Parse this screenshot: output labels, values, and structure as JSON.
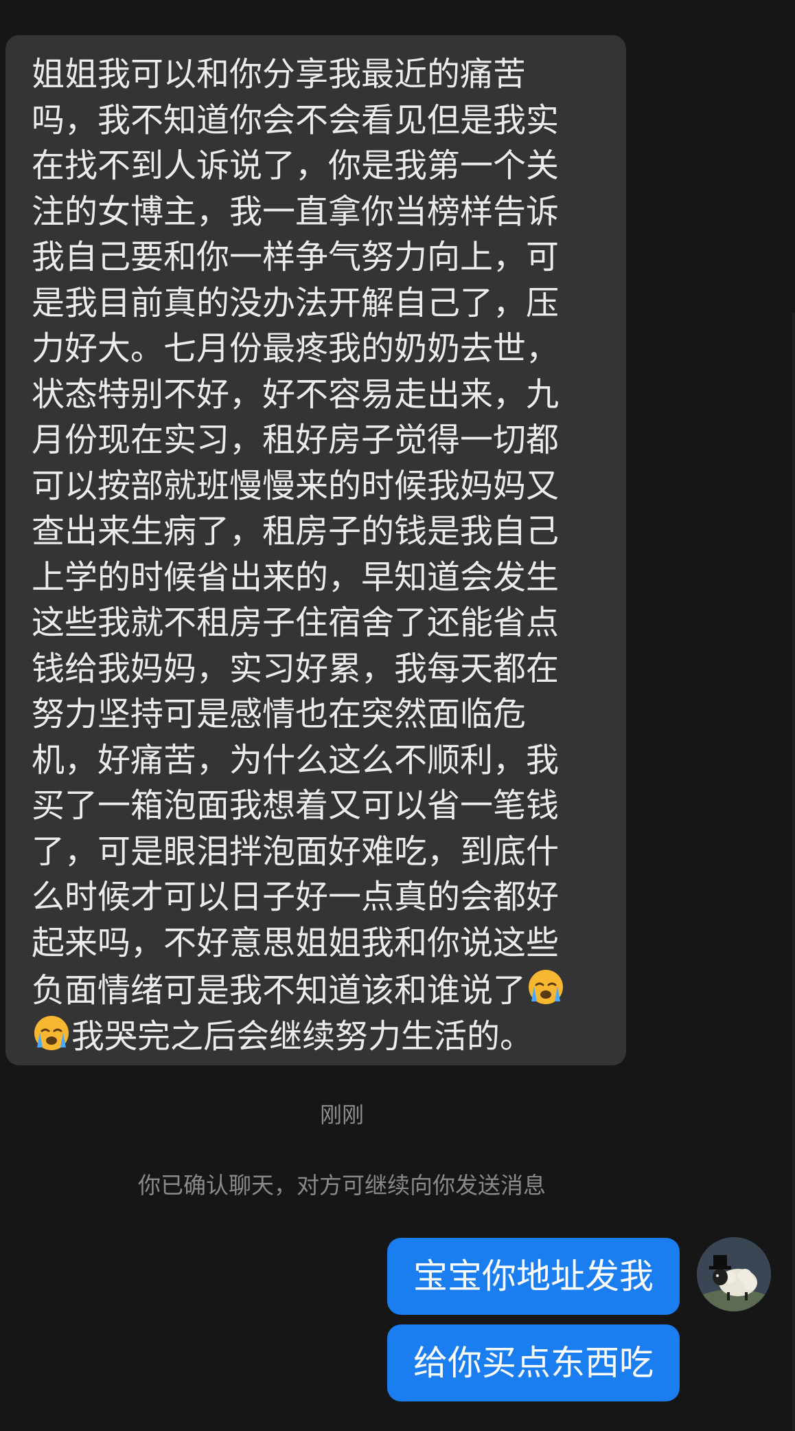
{
  "conversation": {
    "incoming_message": {
      "lines": [
        "姐姐我可以和你分享我最近的痛苦",
        "吗，我不知道你会不会看见但是我实",
        "在找不到人诉说了，你是我第一个关",
        "注的女博主，我一直拿你当榜样告诉",
        "我自己要和你一样争气努力向上，可",
        "是我目前真的没办法开解自己了，压",
        "力好大。七月份最疼我的奶奶去世，",
        "状态特别不好，好不容易走出来，九",
        "月份现在实习，租好房子觉得一切都",
        "可以按部就班慢慢来的时候我妈妈又",
        "查出来生病了，租房子的钱是我自己",
        "上学的时候省出来的，早知道会发生",
        "这些我就不租房子住宿舍了还能省点",
        "钱给我妈妈，实习好累，我每天都在",
        "努力坚持可是感情也在突然面临危",
        "机，好痛苦，为什么这么不顺利，我",
        "买了一箱泡面我想着又可以省一笔钱",
        "了，可是眼泪拌泡面好难吃，到底什",
        "么时候才可以日子好一点真的会都好",
        "起来吗，不好意思姐姐我和你说这些",
        "负面情绪可是我不知道该和谁说了"
      ],
      "last_line": "我哭完之后会继续努力生活的。",
      "emoji_icon": "loudly-crying-face-emoji"
    },
    "timestamp": "刚刚",
    "system_note": "你已确认聊天，对方可继续向你发送消息",
    "outgoing_messages": [
      "宝宝你地址发我",
      "给你买点东西吃"
    ],
    "avatar_icon": "sheep-with-top-hat-avatar"
  },
  "colors": {
    "background": "#161616",
    "incoming_bubble": "#343434",
    "outgoing_bubble": "#1a7df0",
    "text_primary": "#ececec",
    "text_muted": "#8e8e8e"
  }
}
